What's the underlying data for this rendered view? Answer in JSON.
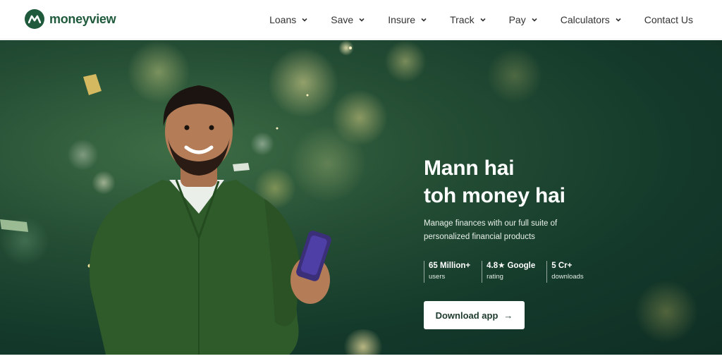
{
  "brand": {
    "name": "moneyview"
  },
  "nav": {
    "items": [
      {
        "label": "Loans",
        "has_dropdown": true
      },
      {
        "label": "Save",
        "has_dropdown": true
      },
      {
        "label": "Insure",
        "has_dropdown": true
      },
      {
        "label": "Track",
        "has_dropdown": true
      },
      {
        "label": "Pay",
        "has_dropdown": true
      },
      {
        "label": "Calculators",
        "has_dropdown": true
      },
      {
        "label": "Contact Us",
        "has_dropdown": false
      }
    ]
  },
  "hero": {
    "headline_line1": "Mann hai",
    "headline_line2": "toh money hai",
    "subtitle_line1": "Manage finances with our full suite of",
    "subtitle_line2": "personalized financial products",
    "stats": [
      {
        "value": "65 Million+",
        "label": "users"
      },
      {
        "value": "4.8★ Google",
        "label": "rating"
      },
      {
        "value": "5 Cr+",
        "label": "downloads"
      }
    ],
    "cta_label": "Download app",
    "cta_icon": "arrow-right-icon"
  },
  "colors": {
    "brand_green": "#1f5a3c",
    "hero_background": "#173f2e",
    "cta_background": "#ffffff",
    "cta_text": "#1e3a2c"
  }
}
